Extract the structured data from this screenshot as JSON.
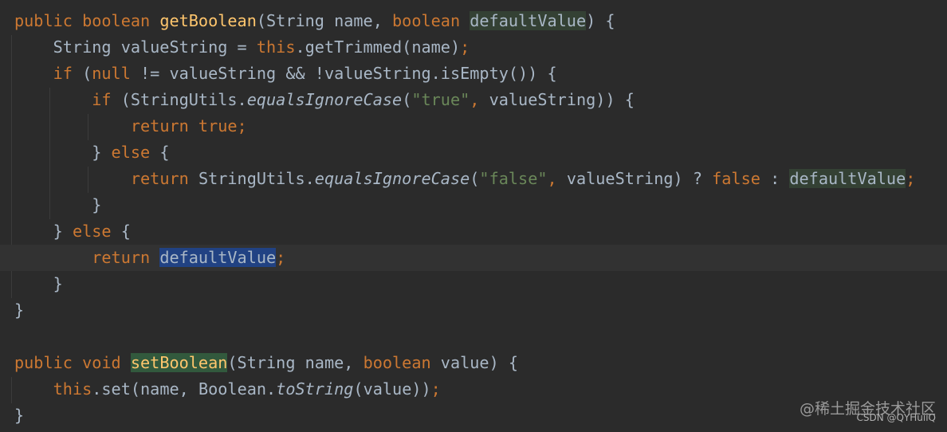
{
  "editor": {
    "lines": [
      [
        {
          "t": "public ",
          "c": "kw"
        },
        {
          "t": "boolean ",
          "c": "kw"
        },
        {
          "t": "getBoolean",
          "c": "fn"
        },
        {
          "t": "(String name, ",
          "c": "pl"
        },
        {
          "t": "boolean ",
          "c": "kw"
        },
        {
          "t": "defaultValue",
          "c": "pl",
          "hl": "green"
        },
        {
          "t": ") {",
          "c": "pl"
        }
      ],
      [
        {
          "t": "    String valueString = ",
          "c": "pl"
        },
        {
          "t": "this",
          "c": "kw"
        },
        {
          "t": ".getTrimmed(name)",
          "c": "pl"
        },
        {
          "t": ";",
          "c": "kw"
        }
      ],
      [
        {
          "t": "    ",
          "c": "pl"
        },
        {
          "t": "if ",
          "c": "kw"
        },
        {
          "t": "(",
          "c": "pl"
        },
        {
          "t": "null ",
          "c": "kw"
        },
        {
          "t": "!= valueString && !valueString.isEmpty()) {",
          "c": "pl"
        }
      ],
      [
        {
          "t": "        ",
          "c": "pl"
        },
        {
          "t": "if ",
          "c": "kw"
        },
        {
          "t": "(StringUtils.",
          "c": "pl"
        },
        {
          "t": "equalsIgnoreCase",
          "c": "it"
        },
        {
          "t": "(",
          "c": "pl"
        },
        {
          "t": "\"true\"",
          "c": "str"
        },
        {
          "t": ", ",
          "c": "kw"
        },
        {
          "t": "valueString)) {",
          "c": "pl"
        }
      ],
      [
        {
          "t": "            ",
          "c": "pl"
        },
        {
          "t": "return true;",
          "c": "kw"
        }
      ],
      [
        {
          "t": "        } ",
          "c": "pl"
        },
        {
          "t": "else ",
          "c": "kw"
        },
        {
          "t": "{",
          "c": "pl"
        }
      ],
      [
        {
          "t": "            ",
          "c": "pl"
        },
        {
          "t": "return ",
          "c": "kw"
        },
        {
          "t": "StringUtils.",
          "c": "pl"
        },
        {
          "t": "equalsIgnoreCase",
          "c": "it"
        },
        {
          "t": "(",
          "c": "pl"
        },
        {
          "t": "\"false\"",
          "c": "str"
        },
        {
          "t": ", ",
          "c": "kw"
        },
        {
          "t": "valueString) ? ",
          "c": "pl"
        },
        {
          "t": "false ",
          "c": "kw"
        },
        {
          "t": ": ",
          "c": "pl"
        },
        {
          "t": "defaultValue",
          "c": "pl",
          "hl": "green"
        },
        {
          "t": ";",
          "c": "kw"
        }
      ],
      [
        {
          "t": "        }",
          "c": "pl"
        }
      ],
      [
        {
          "t": "    } ",
          "c": "pl"
        },
        {
          "t": "else ",
          "c": "kw"
        },
        {
          "t": "{",
          "c": "pl"
        }
      ],
      [
        {
          "t": "        ",
          "c": "pl"
        },
        {
          "t": "return ",
          "c": "kw"
        },
        {
          "t": "defaultValue",
          "c": "pl",
          "hl": "sel"
        },
        {
          "t": ";",
          "c": "kw"
        }
      ],
      [
        {
          "t": "    }",
          "c": "pl"
        }
      ],
      [
        {
          "t": "}",
          "c": "pl"
        }
      ],
      [],
      [
        {
          "t": "public ",
          "c": "kw"
        },
        {
          "t": "void ",
          "c": "kw"
        },
        {
          "t": "setBoolean",
          "c": "fn",
          "hl": "fn"
        },
        {
          "t": "(String name, ",
          "c": "pl"
        },
        {
          "t": "boolean ",
          "c": "kw"
        },
        {
          "t": "value) {",
          "c": "pl"
        }
      ],
      [
        {
          "t": "    ",
          "c": "pl"
        },
        {
          "t": "this",
          "c": "kw"
        },
        {
          "t": ".set(name, ",
          "c": "pl"
        },
        {
          "t": "Boolean.",
          "c": "pl"
        },
        {
          "t": "toString",
          "c": "it"
        },
        {
          "t": "(value))",
          "c": "pl"
        },
        {
          "t": ";",
          "c": "kw"
        }
      ],
      [
        {
          "t": "}",
          "c": "pl"
        }
      ]
    ],
    "current_line_index": 9
  },
  "watermark": {
    "line1": "@稀土掘金技术社区",
    "line2": "CSDN @QYHuiiQ"
  }
}
